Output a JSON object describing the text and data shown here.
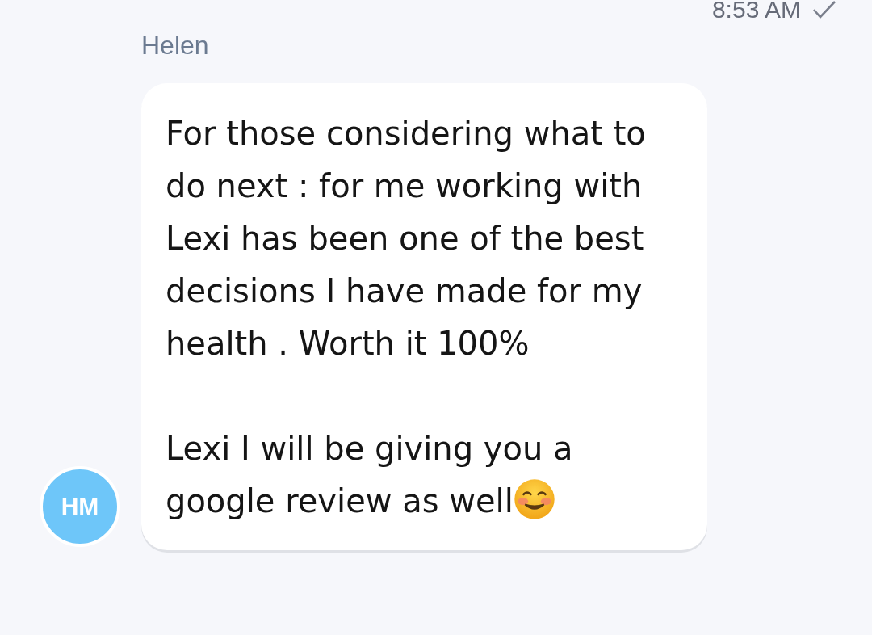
{
  "top_message": {
    "time": "8:53 AM",
    "delivered": true
  },
  "message": {
    "sender": "Helen",
    "avatar_initials": "HM",
    "paragraphs": [
      "For those considering what to do next : for me working with Lexi has been one of the best decisions I have made for my health . Worth it 100%",
      "Lexi I will be giving you a google review as well"
    ],
    "ends_with_emoji": true
  }
}
